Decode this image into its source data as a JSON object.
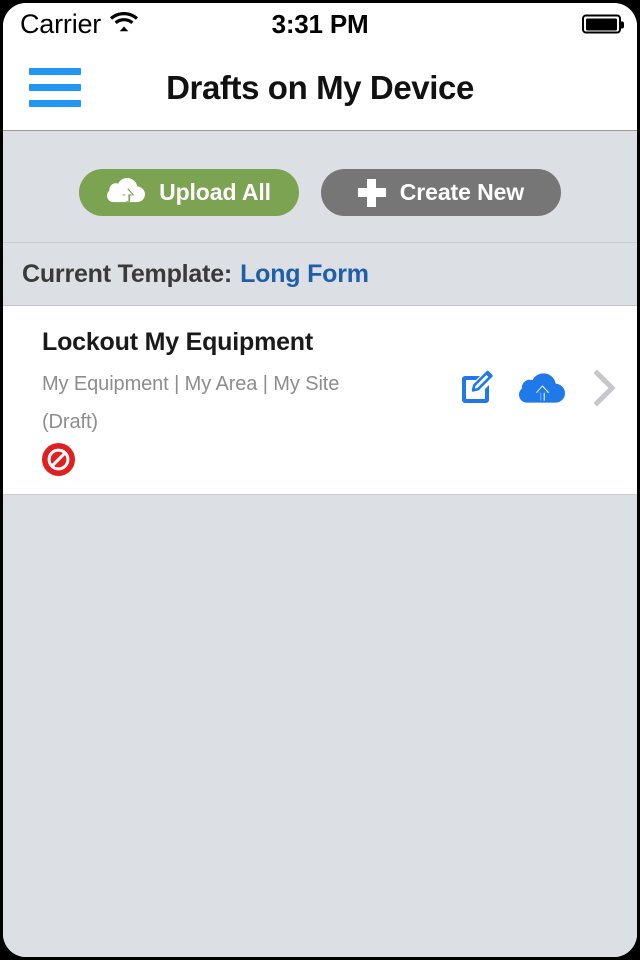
{
  "status_bar": {
    "carrier": "Carrier",
    "wifi_icon": "wifi-icon",
    "time": "3:31 PM",
    "battery_icon": "battery-full-icon"
  },
  "nav_bar": {
    "menu_icon": "hamburger-menu-icon",
    "title": "Drafts on My Device"
  },
  "toolbar": {
    "upload_all_label": "Upload All",
    "upload_all_icon": "cloud-upload-icon",
    "upload_all_color": "#7ba352",
    "create_new_label": "Create New",
    "create_new_icon": "plus-icon",
    "create_new_color": "#767676"
  },
  "template": {
    "label": "Current Template:",
    "value": "Long Form",
    "value_color": "#1f5fa9"
  },
  "list": {
    "rows": [
      {
        "title": "Lockout My Equipment",
        "subtitle": "My Equipment | My Area | My Site",
        "status": "(Draft)",
        "badge_icon": "prohibited-icon",
        "badge_color": "#e02020",
        "edit_icon": "edit-pencil-icon",
        "upload_icon": "cloud-upload-icon",
        "chevron_icon": "chevron-right-icon",
        "action_color": "#2079e8"
      }
    ]
  },
  "colors": {
    "background": "#dcdfe3",
    "card": "#ffffff",
    "accent_blue": "#2196f3"
  }
}
